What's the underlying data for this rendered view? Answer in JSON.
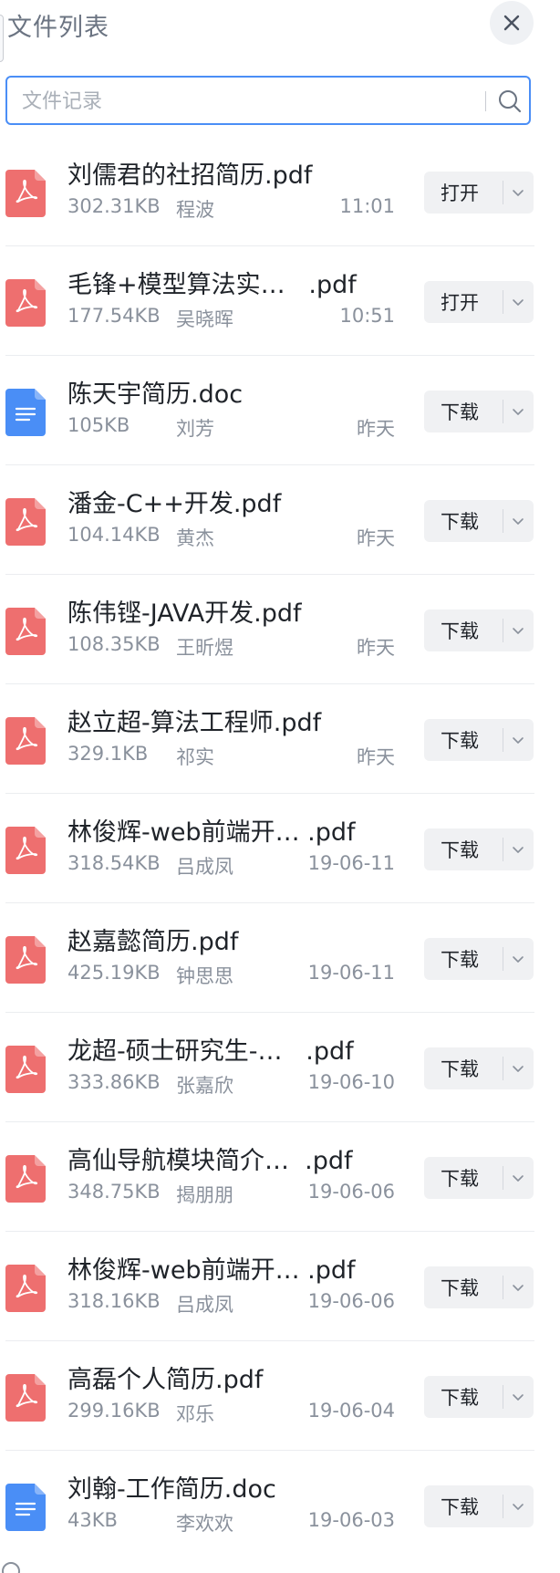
{
  "header": {
    "title": "文件列表",
    "close_icon": "close-icon"
  },
  "search": {
    "placeholder": "文件记录",
    "value": "",
    "icon": "search-icon"
  },
  "colors": {
    "accent": "#4a8ef6",
    "pdf": "#ee6f6f",
    "doc": "#4a8ef6"
  },
  "files": [
    {
      "name": "刘儒君的社招简历.pdf",
      "type": "pdf",
      "size": "302.31KB",
      "user": "程波",
      "time": "11:01",
      "action": "打开"
    },
    {
      "name": "毛锋+模型算法实…   .pdf",
      "type": "pdf",
      "size": "177.54KB",
      "user": "吴晓晖",
      "time": "10:51",
      "action": "打开"
    },
    {
      "name": "陈天宇简历.doc",
      "type": "doc",
      "size": "105KB",
      "user": "刘芳",
      "time": "昨天",
      "action": "下载"
    },
    {
      "name": "潘金-C++开发.pdf",
      "type": "pdf",
      "size": "104.14KB",
      "user": "黄杰",
      "time": "昨天",
      "action": "下载"
    },
    {
      "name": "陈伟铿-JAVA开发.pdf",
      "type": "pdf",
      "size": "108.35KB",
      "user": "王昕煜",
      "time": "昨天",
      "action": "下载"
    },
    {
      "name": "赵立超-算法工程师.pdf",
      "type": "pdf",
      "size": "329.1KB",
      "user": "祁实",
      "time": "昨天",
      "action": "下载"
    },
    {
      "name": "林俊辉-web前端开… .pdf",
      "type": "pdf",
      "size": "318.54KB",
      "user": "吕成凤",
      "time": "19-06-11",
      "action": "下载"
    },
    {
      "name": "赵嘉懿简历.pdf",
      "type": "pdf",
      "size": "425.19KB",
      "user": "钟思思",
      "time": "19-06-11",
      "action": "下载"
    },
    {
      "name": "龙超-硕士研究生-…   .pdf",
      "type": "pdf",
      "size": "333.86KB",
      "user": "张嘉欣",
      "time": "19-06-10",
      "action": "下载"
    },
    {
      "name": "高仙导航模块简介…  .pdf",
      "type": "pdf",
      "size": "348.75KB",
      "user": "揭朋朋",
      "time": "19-06-06",
      "action": "下载"
    },
    {
      "name": "林俊辉-web前端开… .pdf",
      "type": "pdf",
      "size": "318.16KB",
      "user": "吕成凤",
      "time": "19-06-06",
      "action": "下载"
    },
    {
      "name": "高磊个人简历.pdf",
      "type": "pdf",
      "size": "299.16KB",
      "user": "邓乐",
      "time": "19-06-04",
      "action": "下载"
    },
    {
      "name": "刘翰-工作简历.doc",
      "type": "doc",
      "size": "43KB",
      "user": "李欢欢",
      "time": "19-06-03",
      "action": "下载"
    }
  ]
}
